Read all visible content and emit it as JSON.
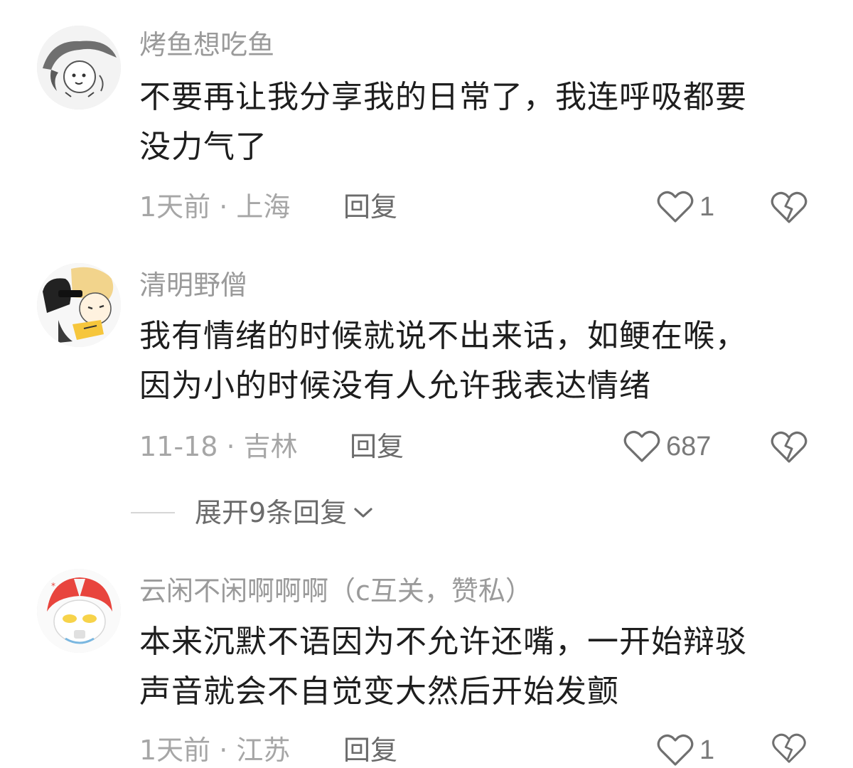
{
  "comments": [
    {
      "username": "烤鱼想吃鱼",
      "text_lines": [
        "不要再让我分享我的日常了，我连呼吸都要",
        "没力气了"
      ],
      "time": "1天前",
      "location": "上海",
      "meta": "1天前 · 上海",
      "reply_label": "回复",
      "likes": "1"
    },
    {
      "username": "清明野僧",
      "text_lines": [
        "我有情绪的时候就说不出来话，如鲠在喉，",
        "因为小的时候没有人允许我表达情绪"
      ],
      "time": "11-18",
      "location": "吉林",
      "meta": "11-18 · 吉林",
      "reply_label": "回复",
      "likes": "687",
      "expand_replies": "展开9条回复"
    },
    {
      "username": "云闲不闲啊啊啊（c互关，赞私）",
      "text_lines": [
        "本来沉默不语因为不允许还嘴，一开始辩驳",
        "声音就会不自觉变大然后开始发颤"
      ],
      "time": "1天前",
      "location": "江苏",
      "meta": "1天前 · 江苏",
      "reply_label": "回复",
      "likes": "1"
    }
  ],
  "icons": {
    "like": "heart-outline-icon",
    "dislike": "broken-heart-icon",
    "expand": "chevron-down-icon"
  },
  "colors": {
    "username": "#9a9a9a",
    "text": "#1e1e1e",
    "meta": "#a6a6a6",
    "action": "#6b6b6b"
  }
}
